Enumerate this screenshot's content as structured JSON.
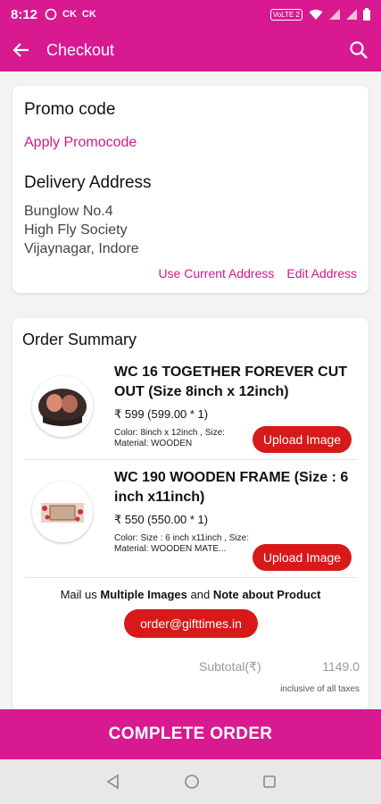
{
  "status_bar": {
    "time": "8:12",
    "left_icons": [
      "whatsapp-icon",
      "CK",
      "CK"
    ],
    "volte": "VoLTE 2",
    "right_icons": [
      "wifi-icon",
      "signal-icon",
      "signal-icon",
      "battery-icon"
    ]
  },
  "app_bar": {
    "title": "Checkout",
    "back_icon": "arrow-left-icon",
    "search_icon": "search-icon"
  },
  "promo": {
    "heading": "Promo code",
    "link": "Apply Promocode"
  },
  "delivery": {
    "heading": "Delivery Address",
    "line1": "Bunglow No.4",
    "line2": "High Fly Society",
    "line3": "Vijaynagar, Indore",
    "use_current": "Use Current Address",
    "edit": "Edit Address"
  },
  "order": {
    "heading": "Order Summary",
    "items": [
      {
        "name": "WC 16 TOGETHER FOREVER CUT OUT (Size  8inch x 12inch)",
        "price": "₹ 599 (599.00 * 1)",
        "attributes": "Color: 8inch x 12inch , Size: Material: WOODEN",
        "upload_label": "Upload Image"
      },
      {
        "name": "WC 190 WOODEN FRAME (Size : 6 inch x11inch)",
        "price": "₹ 550 (550.00 * 1)",
        "attributes": "Color: Size : 6 inch x11inch , Size: Material: WOODEN MATE...",
        "upload_label": "Upload Image"
      }
    ],
    "mail_prefix": "Mail us ",
    "mail_bold1": "Multiple Images",
    "mail_mid": " and ",
    "mail_bold2": "Note about Product",
    "email": "order@gifttimes.in",
    "subtotal_label": "Subtotal(₹)",
    "subtotal_value": "1149.0",
    "tax_note": "inclusive of all taxes"
  },
  "complete_button": "COMPLETE ORDER",
  "nav": [
    "back-triangle-icon",
    "home-circle-icon",
    "recents-square-icon"
  ],
  "colors": {
    "brand_pink": "#d8198f",
    "link_pink": "#d01a86",
    "button_red": "#d81919"
  }
}
